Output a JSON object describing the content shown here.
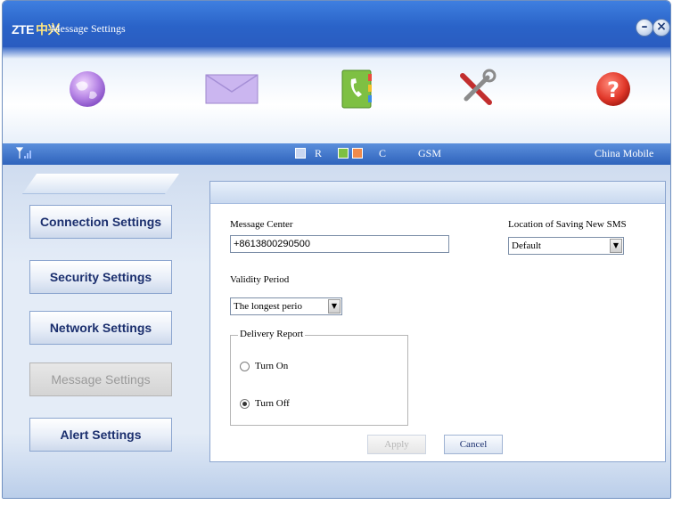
{
  "window": {
    "logo_latin": "ZTE",
    "logo_cn": "中兴",
    "title": "Message Settings",
    "minimize_icon": "minimize-icon",
    "close_icon": "close-icon"
  },
  "toolbar": {
    "items": [
      {
        "name": "internet-globe-icon"
      },
      {
        "name": "messages-envelope-icon"
      },
      {
        "name": "phonebook-icon"
      },
      {
        "name": "settings-tools-icon"
      },
      {
        "name": "help-icon"
      }
    ]
  },
  "statusbar": {
    "signal_icon": "signal-strength-icon",
    "roaming": "R",
    "service": "C",
    "network_type": "GSM",
    "operator": "China Mobile"
  },
  "sidebar": {
    "items": [
      {
        "label": "Connection Settings",
        "enabled": true
      },
      {
        "label": "Security Settings",
        "enabled": true
      },
      {
        "label": "Network Settings",
        "enabled": true
      },
      {
        "label": "Message Settings",
        "enabled": false,
        "selected": true
      },
      {
        "label": "Alert Settings",
        "enabled": true
      }
    ]
  },
  "form": {
    "message_center_label": "Message Center",
    "message_center_value": "+8613800290500",
    "location_label": "Location of Saving New SMS",
    "location_value": "Default",
    "validity_label": "Validity Period",
    "validity_value": "The longest perio",
    "delivery_report": {
      "title": "Delivery Report",
      "options": [
        {
          "label": "Turn On",
          "checked": false
        },
        {
          "label": "Turn Off",
          "checked": true
        }
      ]
    },
    "apply_label": "Apply",
    "cancel_label": "Cancel"
  },
  "colors": {
    "titlebar": "#2a63c8",
    "statusbar": "#2f63bc",
    "sidebar_text": "#1b2f6e"
  }
}
